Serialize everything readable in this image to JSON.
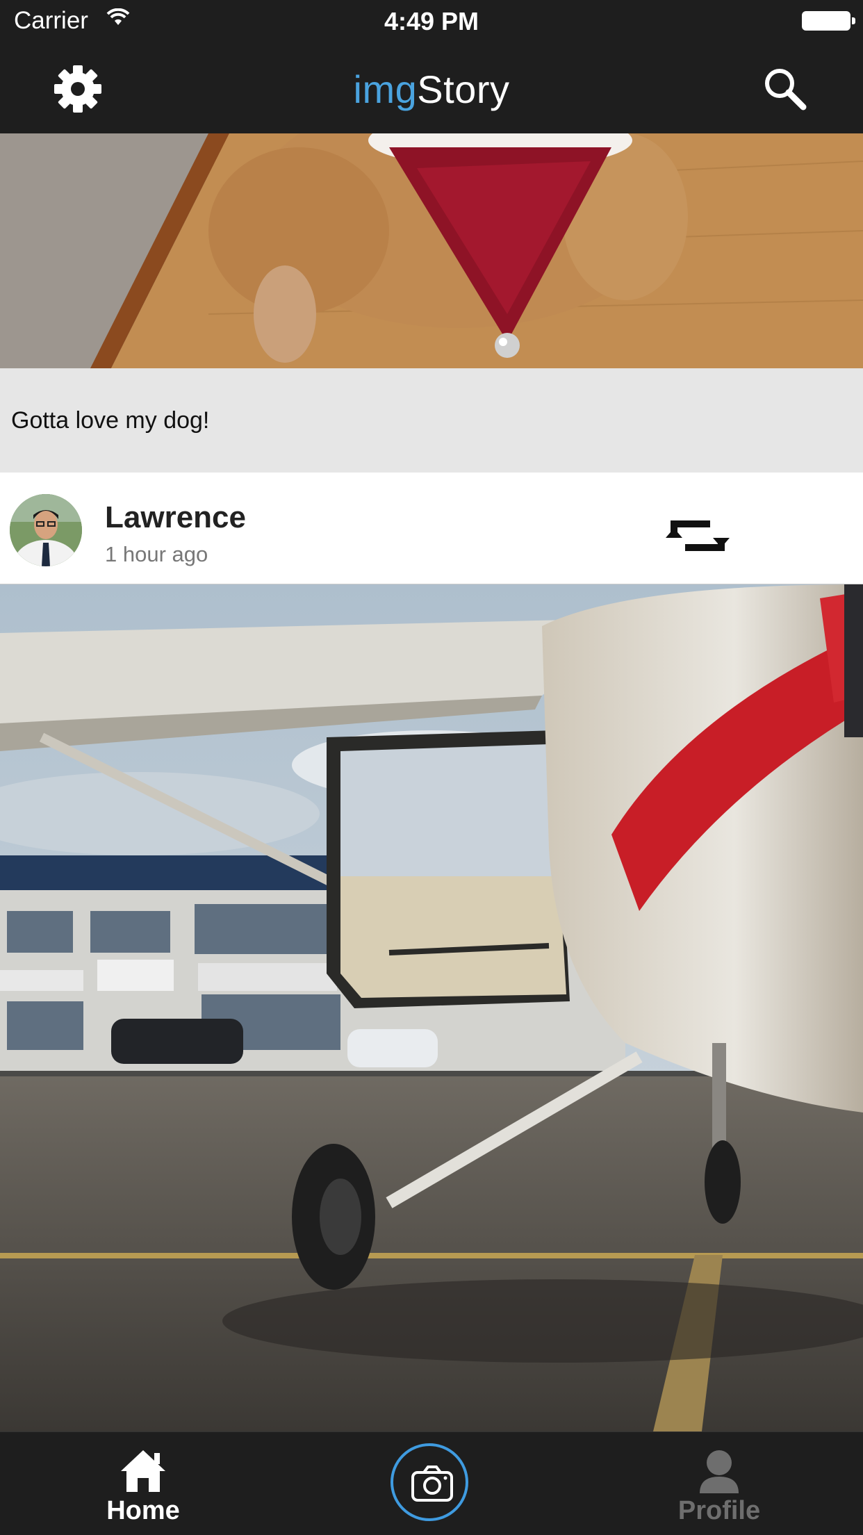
{
  "status_bar": {
    "carrier": "Carrier",
    "time": "4:49 PM"
  },
  "header": {
    "title_accent": "img",
    "title_rest": "Story"
  },
  "posts": [
    {
      "caption": "Gotta love my dog!"
    },
    {
      "username": "Lawrence",
      "timestamp": "1 hour ago"
    }
  ],
  "tab_bar": {
    "home_label": "Home",
    "profile_label": "Profile"
  },
  "colors": {
    "accent": "#4aa3df",
    "camera_ring": "#3f9be0",
    "bar_bg": "#1e1e1e"
  },
  "icons": [
    "wifi-icon",
    "battery-icon",
    "gear-icon",
    "search-icon",
    "repost-icon",
    "home-icon",
    "camera-icon",
    "profile-icon"
  ]
}
